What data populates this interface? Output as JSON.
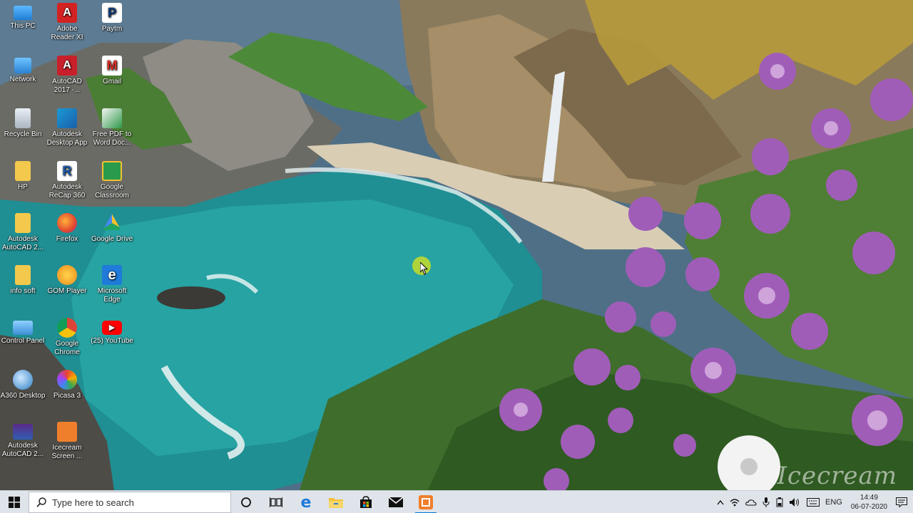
{
  "desktop": {
    "icons": [
      {
        "label": "This PC",
        "icon": "this-pc-icon"
      },
      {
        "label": "Adobe Reader XI",
        "icon": "adobe-reader-icon"
      },
      {
        "label": "Paytm",
        "icon": "paytm-icon"
      },
      {
        "label": "Network",
        "icon": "network-icon"
      },
      {
        "label": "AutoCAD 2017 -...",
        "icon": "autocad-icon"
      },
      {
        "label": "Gmail",
        "icon": "gmail-icon"
      },
      {
        "label": "Recycle Bin",
        "icon": "recycle-bin-icon"
      },
      {
        "label": "Autodesk Desktop App",
        "icon": "autodesk-desktop-app-icon"
      },
      {
        "label": "Free PDF to Word Doc...",
        "icon": "pdf-to-word-icon"
      },
      {
        "label": "HP",
        "icon": "folder-icon"
      },
      {
        "label": "Autodesk ReCap 360",
        "icon": "autodesk-recap-icon"
      },
      {
        "label": "Google Classroom",
        "icon": "google-classroom-icon"
      },
      {
        "label": "Autodesk AutoCAD 2...",
        "icon": "folder-icon"
      },
      {
        "label": "Firefox",
        "icon": "firefox-icon"
      },
      {
        "label": "Google Drive",
        "icon": "google-drive-icon"
      },
      {
        "label": "info soft",
        "icon": "folder-icon"
      },
      {
        "label": "GOM Player",
        "icon": "gom-player-icon"
      },
      {
        "label": "Microsoft Edge",
        "icon": "edge-icon"
      },
      {
        "label": "Control Panel",
        "icon": "control-panel-icon"
      },
      {
        "label": "Google Chrome",
        "icon": "chrome-icon"
      },
      {
        "label": "(25) YouTube",
        "icon": "youtube-icon"
      },
      {
        "label": "A360 Desktop",
        "icon": "a360-icon"
      },
      {
        "label": "Picasa 3",
        "icon": "picasa-icon"
      },
      {
        "label": "Autodesk AutoCAD 2...",
        "icon": "autocad-folder-icon"
      },
      {
        "label": "Icecream Screen ...",
        "icon": "icecream-icon"
      }
    ]
  },
  "taskbar": {
    "search_placeholder": "Type here to search",
    "pinned": [
      {
        "icon": "cortana-icon"
      },
      {
        "icon": "task-view-icon"
      },
      {
        "icon": "edge-icon"
      },
      {
        "icon": "file-explorer-icon"
      },
      {
        "icon": "store-icon"
      },
      {
        "icon": "mail-icon"
      },
      {
        "icon": "icecream-recorder-icon",
        "active": true
      }
    ],
    "tray": {
      "language": "ENG",
      "time": "14:49",
      "date": "06-07-2020"
    }
  },
  "watermark": "Icecream",
  "colors": {
    "accent": "#0078d7",
    "taskbar": "#dfe4ea"
  }
}
